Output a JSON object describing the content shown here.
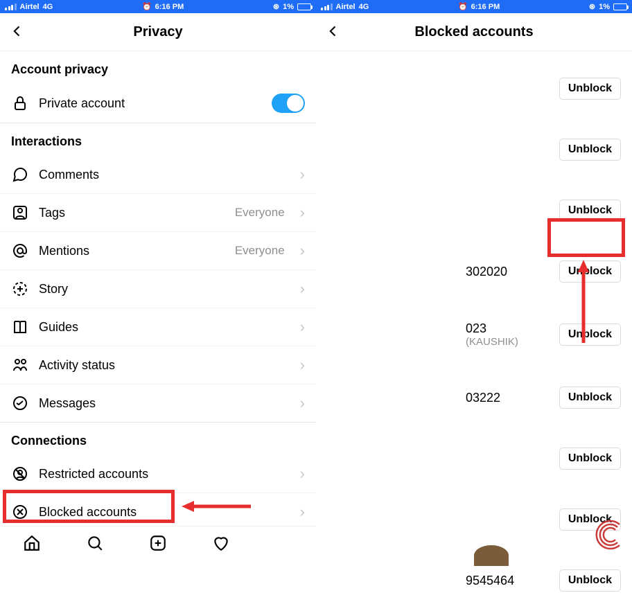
{
  "status": {
    "carrier": "Airtel",
    "network": "4G",
    "time": "6:16 PM",
    "battery_text": "1%"
  },
  "left": {
    "title": "Privacy",
    "section_account": "Account privacy",
    "private_account": "Private account",
    "section_interactions": "Interactions",
    "everyone": "Everyone",
    "items": {
      "comments": "Comments",
      "tags": "Tags",
      "mentions": "Mentions",
      "story": "Story",
      "guides": "Guides",
      "activity_status": "Activity status",
      "messages": "Messages"
    },
    "section_connections": "Connections",
    "conn": {
      "restricted": "Restricted accounts",
      "blocked": "Blocked accounts"
    }
  },
  "right": {
    "title": "Blocked accounts",
    "unblock": "Unblock",
    "rows": [
      {
        "uname": "",
        "sub": ""
      },
      {
        "uname": "",
        "sub": ""
      },
      {
        "uname": "",
        "sub": ""
      },
      {
        "uname": "302020",
        "sub": ""
      },
      {
        "uname": "023",
        "sub": "(KAUSHIK)"
      },
      {
        "uname": "03222",
        "sub": ""
      },
      {
        "uname": "",
        "sub": ""
      },
      {
        "uname": "",
        "sub": ""
      },
      {
        "uname": "9545464",
        "sub": ""
      }
    ]
  }
}
